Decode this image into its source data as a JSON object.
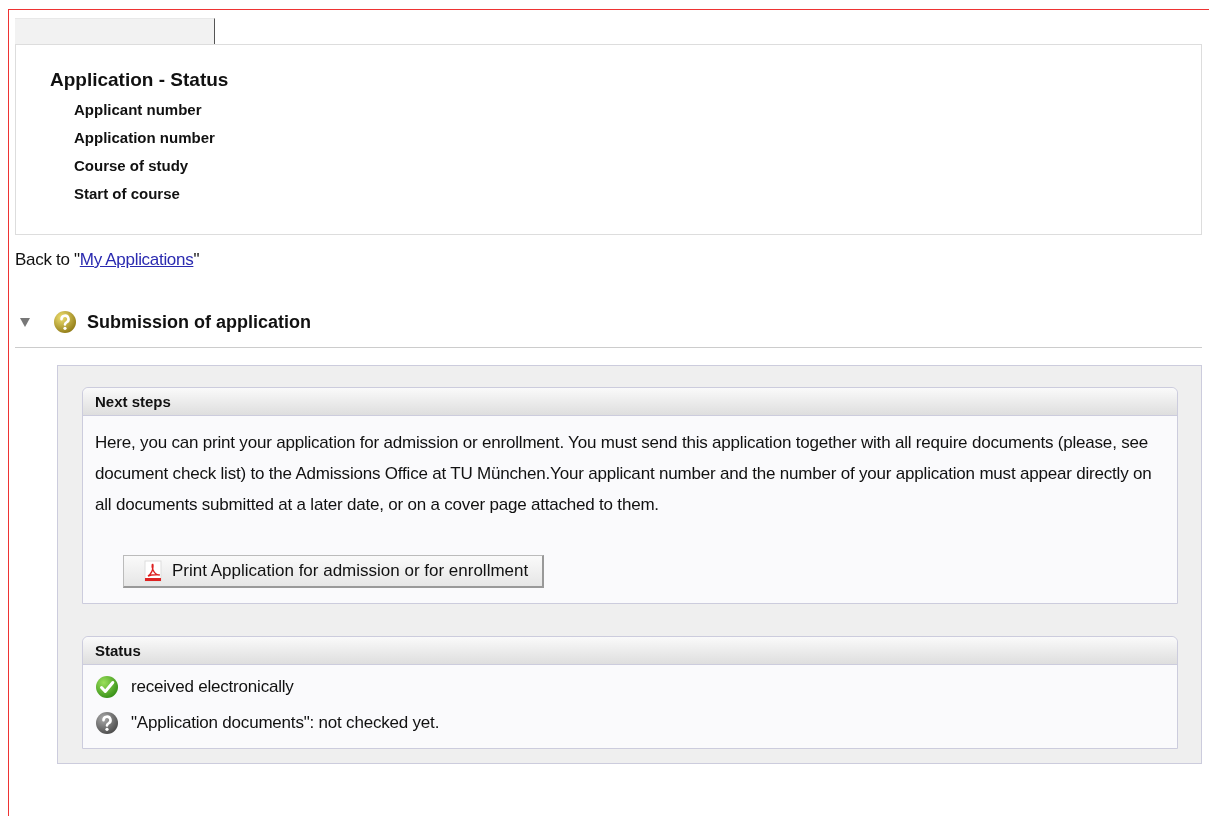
{
  "header": {
    "title": "Application - Status",
    "fields": [
      "Applicant number",
      "Application number",
      "Course of study",
      "Start of course"
    ]
  },
  "back_link": {
    "prefix": "Back to \"",
    "link": "My Applications",
    "suffix": "\""
  },
  "section": {
    "title": "Submission of application",
    "expanded": true,
    "next_steps": {
      "title": "Next steps",
      "text": "Here, you can print your application for admission or enrollment. You must send this application together with all require documents (please, see document check list) to the Admissions Office at TU München.Your applicant number and the number of your application must appear directly on all documents submitted at a later date, or on a cover page attached to them.",
      "button": "Print Application for admission or for enrollment"
    },
    "status": {
      "title": "Status",
      "items": [
        {
          "kind": "ok",
          "text": "received electronically"
        },
        {
          "kind": "unknown",
          "text": "\"Application documents\": not checked yet."
        }
      ]
    }
  }
}
